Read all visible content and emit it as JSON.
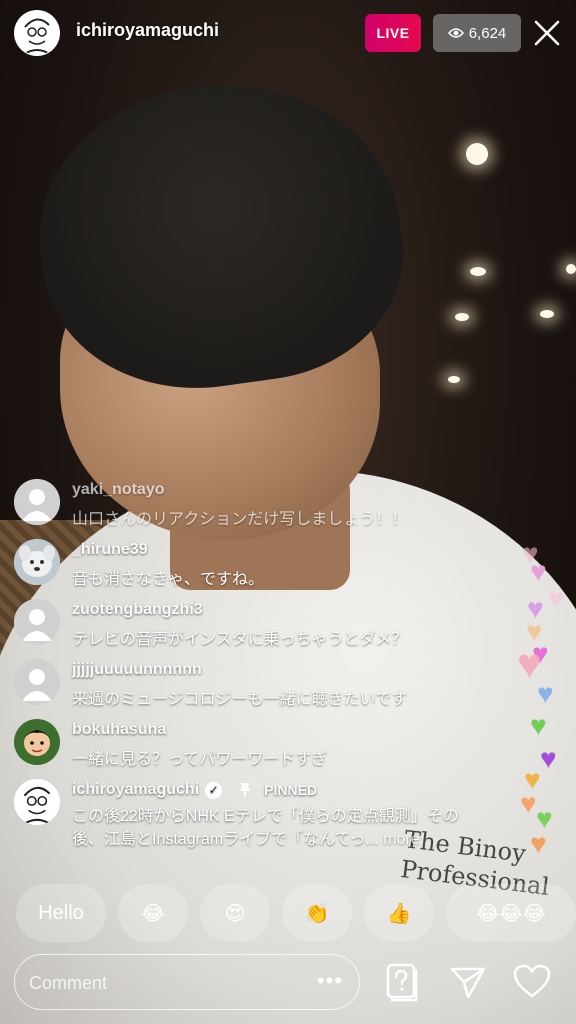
{
  "header": {
    "host_name": "ichiroyamaguchi",
    "live_label": "LIVE",
    "viewer_count": "6,624",
    "live_color": "#e1006a"
  },
  "comments": [
    {
      "user": "yaki_notayo",
      "text": "山口さんのリアクションだけ写しましょう！！"
    },
    {
      "user": "_hirune39",
      "text": "音も消さなきゃ、ですね。"
    },
    {
      "user": "zuotengbangzhi3",
      "text": "テレビの音声がインスタに乗っちゃうとダメ？"
    },
    {
      "user": "jjjjjuuuuunnnnnn",
      "text": "来週のミュージコロジーも一緒に聴きたいです"
    },
    {
      "user": "bokuhasuna",
      "text": "一緒に見る？ってパワーワードすぎ"
    }
  ],
  "pinned_comment": {
    "user": "ichiroyamaguchi",
    "pinned_label": "PINNED",
    "text_line1": "この後22時からNHK Eテレで「僕らの定点観測」その",
    "text_line2": "後、江島とInstagramライブで「なんてっ...",
    "more_label": "more"
  },
  "quick_replies": [
    "Hello",
    "😂",
    "😍",
    "👏",
    "👍",
    "😂😂😂"
  ],
  "shirt_text": {
    "line1": "The Binoy",
    "line2": "Professional"
  },
  "composer": {
    "placeholder": "Comment",
    "more_dots": "•••"
  },
  "icons": {
    "close": "close-icon",
    "viewers": "eye-icon",
    "verified": "verified-badge-icon",
    "pin": "pin-icon",
    "question": "question-sticker-icon",
    "send": "send-icon",
    "like": "heart-icon"
  }
}
